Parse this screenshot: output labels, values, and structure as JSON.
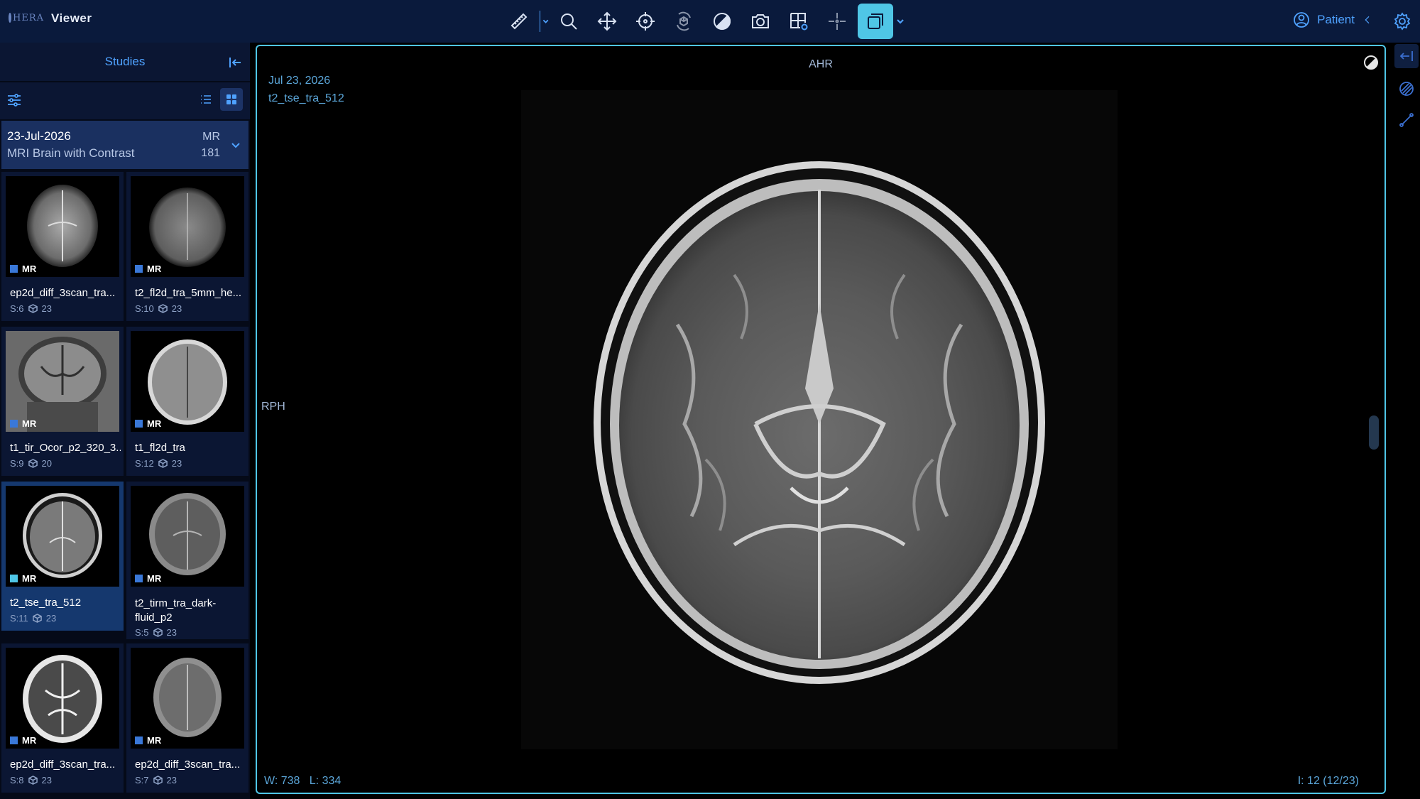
{
  "header": {
    "logo_text": "HERA",
    "app_title": "Viewer",
    "tools": [
      {
        "name": "measure-icon"
      },
      {
        "name": "zoom-icon"
      },
      {
        "name": "pan-icon"
      },
      {
        "name": "crosshair-icon"
      },
      {
        "name": "rotate-3d-icon"
      },
      {
        "name": "window-level-icon"
      },
      {
        "name": "camera-icon"
      },
      {
        "name": "layout-icon"
      },
      {
        "name": "reference-lines-icon"
      },
      {
        "name": "stack-sync-icon",
        "active": true
      }
    ],
    "patient_label": "Patient"
  },
  "studies_panel": {
    "title": "Studies",
    "study": {
      "date": "23-Jul-2026",
      "description": "MRI Brain with Contrast",
      "modality": "MR",
      "count": "181"
    },
    "series": [
      {
        "name": "ep2d_diff_3scan_tra...",
        "modality": "MR",
        "series_no": "S:6",
        "images": "23"
      },
      {
        "name": "t2_fl2d_tra_5mm_he...",
        "modality": "MR",
        "series_no": "S:10",
        "images": "23"
      },
      {
        "name": "t1_tir_Ocor_p2_320_3...",
        "modality": "MR",
        "series_no": "S:9",
        "images": "20"
      },
      {
        "name": "t1_fl2d_tra",
        "modality": "MR",
        "series_no": "S:12",
        "images": "23"
      },
      {
        "name": "t2_tse_tra_512",
        "modality": "MR",
        "series_no": "S:11",
        "images": "23",
        "selected": true
      },
      {
        "name": "t2_tirm_tra_dark-fluid_p2",
        "modality": "MR",
        "series_no": "S:5",
        "images": "23"
      },
      {
        "name": "ep2d_diff_3scan_tra...",
        "modality": "MR",
        "series_no": "S:8",
        "images": "23"
      },
      {
        "name": "ep2d_diff_3scan_tra...",
        "modality": "MR",
        "series_no": "S:7",
        "images": "23"
      }
    ]
  },
  "viewport": {
    "date": "Jul 23, 2026",
    "series_name": "t2_tse_tra_512",
    "orientation_top": "AHR",
    "orientation_left": "RPH",
    "window_label": "W:",
    "window_value": "738",
    "level_label": "L:",
    "level_value": "334",
    "image_index": "I: 12 (12/23)"
  },
  "colors": {
    "topbar": "#0a1a3c",
    "accent": "#4fa2ff",
    "active_tool": "#4fc6e6",
    "selected_series": "#15386e"
  }
}
